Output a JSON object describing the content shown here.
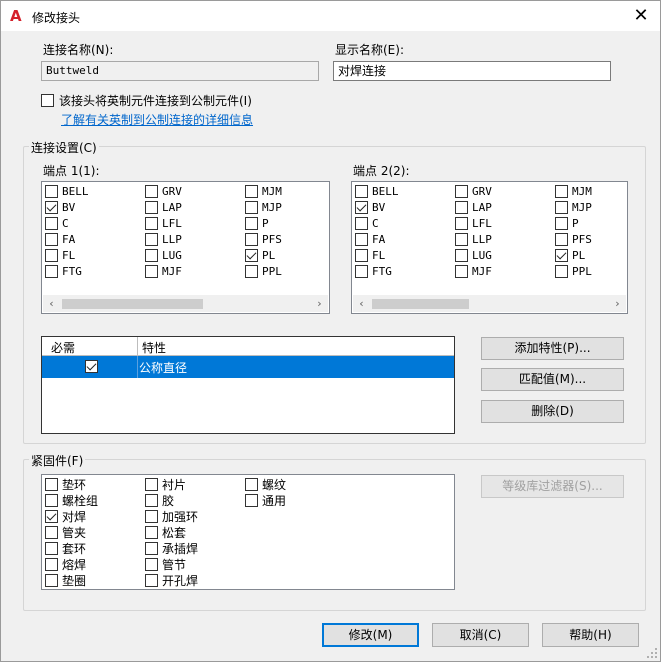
{
  "window": {
    "title": "修改接头",
    "close_glyph": "✕"
  },
  "connection_name": {
    "label": "连接名称(N):",
    "value": "Buttweld"
  },
  "display_name": {
    "label": "显示名称(E):",
    "value": "对焊连接"
  },
  "imperial_option": {
    "label": "该接头将英制元件连接到公制元件(I)",
    "checked": false
  },
  "details_link": "了解有关英制到公制连接的详细信息",
  "connection_settings": {
    "title": "连接设置(C)",
    "port1": {
      "label": "端点 1(1):",
      "items": [
        {
          "code": "BELL",
          "checked": false
        },
        {
          "code": "BV",
          "checked": true
        },
        {
          "code": "C",
          "checked": false
        },
        {
          "code": "FA",
          "checked": false
        },
        {
          "code": "FL",
          "checked": false
        },
        {
          "code": "FTG",
          "checked": false
        },
        {
          "code": "GRV",
          "checked": false
        },
        {
          "code": "LAP",
          "checked": false
        },
        {
          "code": "LFL",
          "checked": false
        },
        {
          "code": "LLP",
          "checked": false
        },
        {
          "code": "LUG",
          "checked": false
        },
        {
          "code": "MJF",
          "checked": false
        },
        {
          "code": "MJM",
          "checked": false
        },
        {
          "code": "MJP",
          "checked": false
        },
        {
          "code": "P",
          "checked": false
        },
        {
          "code": "PFS",
          "checked": false
        },
        {
          "code": "PL",
          "checked": true
        },
        {
          "code": "PPL",
          "checked": false
        }
      ]
    },
    "port2": {
      "label": "端点 2(2):",
      "items": [
        {
          "code": "BELL",
          "checked": false
        },
        {
          "code": "BV",
          "checked": true
        },
        {
          "code": "C",
          "checked": false
        },
        {
          "code": "FA",
          "checked": false
        },
        {
          "code": "FL",
          "checked": false
        },
        {
          "code": "FTG",
          "checked": false
        },
        {
          "code": "GRV",
          "checked": false
        },
        {
          "code": "LAP",
          "checked": false
        },
        {
          "code": "LFL",
          "checked": false
        },
        {
          "code": "LLP",
          "checked": false
        },
        {
          "code": "LUG",
          "checked": false
        },
        {
          "code": "MJF",
          "checked": false
        },
        {
          "code": "MJM",
          "checked": false
        },
        {
          "code": "MJP",
          "checked": false
        },
        {
          "code": "P",
          "checked": false
        },
        {
          "code": "PFS",
          "checked": false
        },
        {
          "code": "PL",
          "checked": true
        },
        {
          "code": "PPL",
          "checked": false
        }
      ]
    },
    "properties_grid": {
      "headers": {
        "required": "必需",
        "property": "特性"
      },
      "rows": [
        {
          "required": true,
          "property": "公称直径"
        }
      ]
    },
    "buttons": {
      "add_property": "添加特性(P)...",
      "match_values": "匹配值(M)...",
      "delete": "删除(D)"
    }
  },
  "fasteners": {
    "title": "紧固件(F)",
    "items": [
      {
        "name": "垫环",
        "checked": false
      },
      {
        "name": "螺栓组",
        "checked": false
      },
      {
        "name": "对焊",
        "checked": true
      },
      {
        "name": "管夹",
        "checked": false
      },
      {
        "name": "套环",
        "checked": false
      },
      {
        "name": "熔焊",
        "checked": false
      },
      {
        "name": "垫圈",
        "checked": false
      },
      {
        "name": "衬片",
        "checked": false
      },
      {
        "name": "胶",
        "checked": false
      },
      {
        "name": "加强环",
        "checked": false
      },
      {
        "name": "松套",
        "checked": false
      },
      {
        "name": "承插焊",
        "checked": false
      },
      {
        "name": "管节",
        "checked": false
      },
      {
        "name": "开孔焊",
        "checked": false
      },
      {
        "name": "螺纹",
        "checked": false
      },
      {
        "name": "通用",
        "checked": false
      }
    ],
    "filter_button": "等级库过滤器(S)..."
  },
  "footer": {
    "modify": "修改(M)",
    "cancel": "取消(C)",
    "help": "帮助(H)"
  },
  "colors": {
    "accent": "#0078d7",
    "link": "#0066cc",
    "app_icon": "#d4202a"
  }
}
